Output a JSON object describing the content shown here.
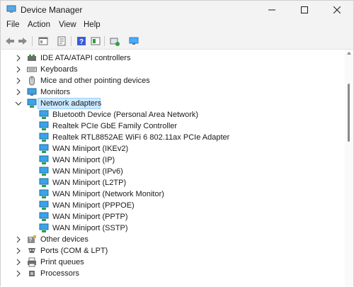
{
  "window": {
    "title": "Device Manager",
    "accent": "#0078d4",
    "selection_color": "#cce8ff"
  },
  "menu": [
    "File",
    "Action",
    "View",
    "Help"
  ],
  "toolbar": [
    "back-icon",
    "forward-icon",
    "properties-icon",
    "update-driver-icon",
    "help-icon",
    "show-hidden-icon",
    "scan-hardware-icon",
    "monitor-icon"
  ],
  "tree": {
    "categories": [
      {
        "label": "IDE ATA/ATAPI controllers",
        "icon": "ide-controller-icon",
        "expanded": false
      },
      {
        "label": "Keyboards",
        "icon": "keyboard-icon",
        "expanded": false
      },
      {
        "label": "Mice and other pointing devices",
        "icon": "mouse-icon",
        "expanded": false
      },
      {
        "label": "Monitors",
        "icon": "monitor-icon",
        "expanded": false
      },
      {
        "label": "Network adapters",
        "icon": "network-adapter-icon",
        "expanded": true,
        "selected": true
      },
      {
        "label": "Other devices",
        "icon": "unknown-device-icon",
        "expanded": false
      },
      {
        "label": "Ports (COM & LPT)",
        "icon": "port-icon",
        "expanded": false
      },
      {
        "label": "Print queues",
        "icon": "printer-icon",
        "expanded": false
      },
      {
        "label": "Processors",
        "icon": "processor-icon",
        "expanded": false
      }
    ],
    "network_adapters": [
      "Bluetooth Device (Personal Area Network)",
      "Realtek PCIe GbE Family Controller",
      "Realtek RTL8852AE WiFi 6 802.11ax PCIe Adapter",
      "WAN Miniport (IKEv2)",
      "WAN Miniport (IP)",
      "WAN Miniport (IPv6)",
      "WAN Miniport (L2TP)",
      "WAN Miniport (Network Monitor)",
      "WAN Miniport (PPPOE)",
      "WAN Miniport (PPTP)",
      "WAN Miniport (SSTP)"
    ]
  }
}
